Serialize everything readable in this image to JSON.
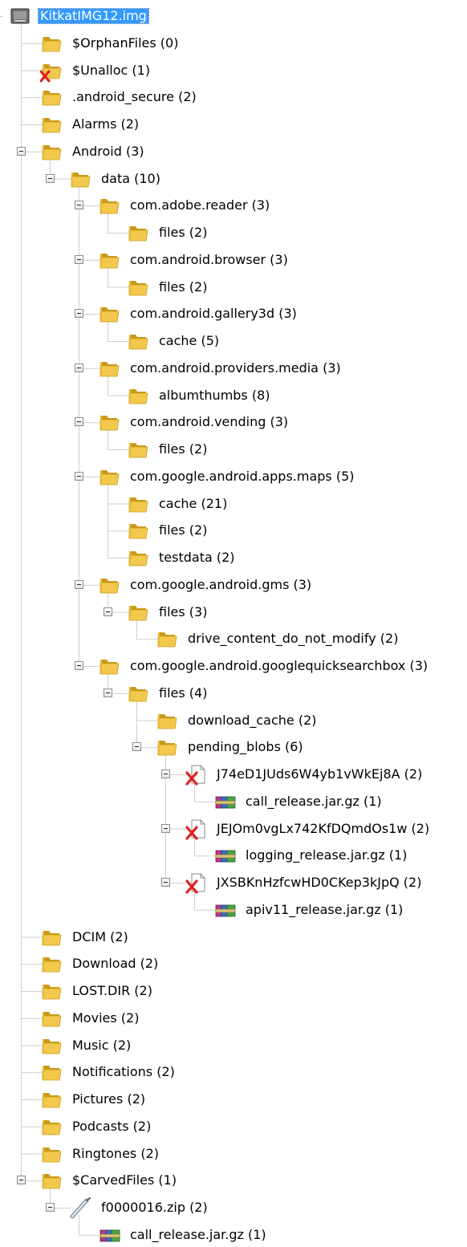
{
  "colors": {
    "folder": "#f2c94c",
    "folder_dark": "#c99a1a",
    "selection": "#3399ff",
    "deleted_mark": "#e02020",
    "tree_line": "#a0a0a0"
  },
  "rows": [
    {
      "label": "KitkatIMG12.img",
      "icon": "disk-image-icon",
      "level": 0,
      "expander": false,
      "selected": true
    },
    {
      "label": "$OrphanFiles (0)",
      "icon": "folder-icon",
      "level": 1,
      "expander": false
    },
    {
      "label": "$Unalloc (1)",
      "icon": "deleted-folder-icon",
      "level": 1,
      "expander": false
    },
    {
      "label": ".android_secure (2)",
      "icon": "folder-icon",
      "level": 1,
      "expander": false
    },
    {
      "label": "Alarms (2)",
      "icon": "folder-icon",
      "level": 1,
      "expander": false
    },
    {
      "label": "Android (3)",
      "icon": "folder-icon",
      "level": 1,
      "expander": true
    },
    {
      "label": "data (10)",
      "icon": "folder-icon",
      "level": 2,
      "expander": true
    },
    {
      "label": "com.adobe.reader (3)",
      "icon": "folder-icon",
      "level": 3,
      "expander": true
    },
    {
      "label": "files (2)",
      "icon": "folder-icon",
      "level": 4,
      "expander": false
    },
    {
      "label": "com.android.browser (3)",
      "icon": "folder-icon",
      "level": 3,
      "expander": true
    },
    {
      "label": "files (2)",
      "icon": "folder-icon",
      "level": 4,
      "expander": false
    },
    {
      "label": "com.android.gallery3d (3)",
      "icon": "folder-icon",
      "level": 3,
      "expander": true
    },
    {
      "label": "cache (5)",
      "icon": "folder-icon",
      "level": 4,
      "expander": false
    },
    {
      "label": "com.android.providers.media (3)",
      "icon": "folder-icon",
      "level": 3,
      "expander": true
    },
    {
      "label": "albumthumbs (8)",
      "icon": "folder-icon",
      "level": 4,
      "expander": false
    },
    {
      "label": "com.android.vending (3)",
      "icon": "folder-icon",
      "level": 3,
      "expander": true
    },
    {
      "label": "files (2)",
      "icon": "folder-icon",
      "level": 4,
      "expander": false
    },
    {
      "label": "com.google.android.apps.maps (5)",
      "icon": "folder-icon",
      "level": 3,
      "expander": true
    },
    {
      "label": "cache (21)",
      "icon": "folder-icon",
      "level": 4,
      "expander": false
    },
    {
      "label": "files (2)",
      "icon": "folder-icon",
      "level": 4,
      "expander": false
    },
    {
      "label": "testdata (2)",
      "icon": "folder-icon",
      "level": 4,
      "expander": false
    },
    {
      "label": "com.google.android.gms (3)",
      "icon": "folder-icon",
      "level": 3,
      "expander": true
    },
    {
      "label": "files (3)",
      "icon": "folder-icon",
      "level": 4,
      "expander": true
    },
    {
      "label": "drive_content_do_not_modify (2)",
      "icon": "folder-icon",
      "level": 5,
      "expander": false
    },
    {
      "label": "com.google.android.googlequicksearchbox (3)",
      "icon": "folder-icon",
      "level": 3,
      "expander": true
    },
    {
      "label": "files (4)",
      "icon": "folder-icon",
      "level": 4,
      "expander": true
    },
    {
      "label": "download_cache (2)",
      "icon": "folder-icon",
      "level": 5,
      "expander": false
    },
    {
      "label": "pending_blobs (6)",
      "icon": "folder-icon",
      "level": 5,
      "expander": true
    },
    {
      "label": "J74eD1JUds6W4yb1vWkEj8A (2)",
      "icon": "deleted-file-icon",
      "level": 6,
      "expander": true
    },
    {
      "label": "call_release.jar.gz (1)",
      "icon": "archive-icon",
      "level": 7,
      "expander": false
    },
    {
      "label": "JEJOm0vgLx742KfDQmdOs1w (2)",
      "icon": "deleted-file-icon",
      "level": 6,
      "expander": true
    },
    {
      "label": "logging_release.jar.gz (1)",
      "icon": "archive-icon",
      "level": 7,
      "expander": false
    },
    {
      "label": "JXSBKnHzfcwHD0CKep3kJpQ (2)",
      "icon": "deleted-file-icon",
      "level": 6,
      "expander": true
    },
    {
      "label": "apiv11_release.jar.gz (1)",
      "icon": "archive-icon",
      "level": 7,
      "expander": false
    },
    {
      "label": "DCIM (2)",
      "icon": "folder-icon",
      "level": 1,
      "expander": false
    },
    {
      "label": "Download (2)",
      "icon": "folder-icon",
      "level": 1,
      "expander": false
    },
    {
      "label": "LOST.DIR (2)",
      "icon": "folder-icon",
      "level": 1,
      "expander": false
    },
    {
      "label": "Movies (2)",
      "icon": "folder-icon",
      "level": 1,
      "expander": false
    },
    {
      "label": "Music (2)",
      "icon": "folder-icon",
      "level": 1,
      "expander": false
    },
    {
      "label": "Notifications (2)",
      "icon": "folder-icon",
      "level": 1,
      "expander": false
    },
    {
      "label": "Pictures (2)",
      "icon": "folder-icon",
      "level": 1,
      "expander": false
    },
    {
      "label": "Podcasts (2)",
      "icon": "folder-icon",
      "level": 1,
      "expander": false
    },
    {
      "label": "Ringtones (2)",
      "icon": "folder-icon",
      "level": 1,
      "expander": false
    },
    {
      "label": "$CarvedFiles (1)",
      "icon": "folder-icon",
      "level": 1,
      "expander": true
    },
    {
      "label": "f0000016.zip (2)",
      "icon": "zip-file-icon",
      "level": 2,
      "expander": true
    },
    {
      "label": "call_release.jar.gz (1)",
      "icon": "archive-icon",
      "level": 3,
      "expander": false
    }
  ]
}
